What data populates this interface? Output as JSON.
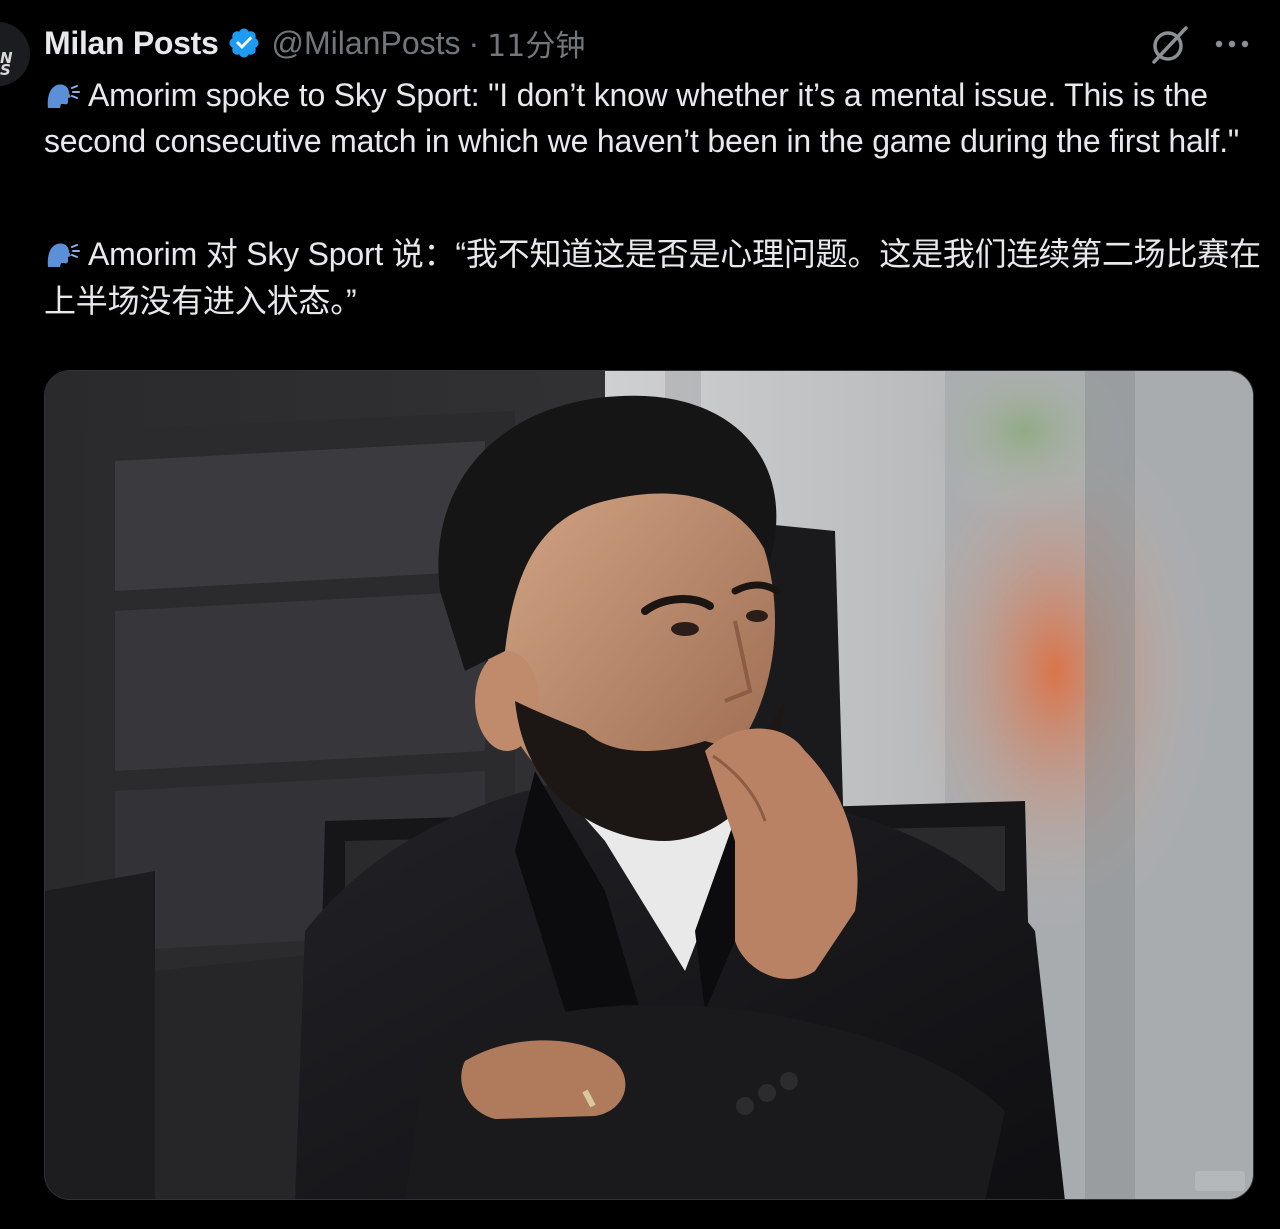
{
  "tweet": {
    "author": {
      "display_name": "Milan Posts",
      "handle": "@MilanPosts",
      "avatar_text": "N\nS",
      "verified": true,
      "verified_color": "#1d9bf0"
    },
    "separator": "·",
    "timestamp": "11分钟",
    "paragraphs": [
      {
        "emoji": "speaking-head",
        "text": "Amorim spoke to Sky Sport: \"I don’t know whether it’s a mental issue. This is the second consecutive match in which we haven’t been in the game during the first half.\""
      },
      {
        "emoji": "speaking-head",
        "text": "Amorim 对 Sky Sport 说：“我不知道这是否是心理问题。这是我们连续第二场比赛在上半场没有进入状态。”"
      }
    ],
    "actions": {
      "grok_icon": "grok-slash-icon",
      "more_icon": "more-horizontal-icon"
    },
    "media": {
      "type": "photo",
      "subject": "man in dark suit seated in black bench chair, hand on chin"
    }
  },
  "colors": {
    "background": "#000000",
    "text_primary": "#e7e9ea",
    "text_secondary": "#71767b",
    "accent": "#1d9bf0"
  }
}
